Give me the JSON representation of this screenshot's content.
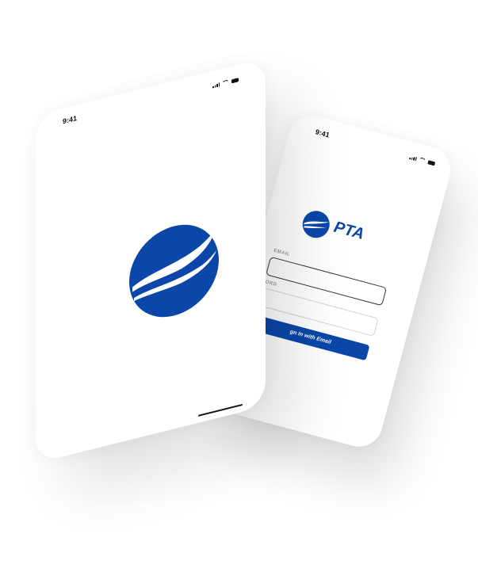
{
  "splash_screen": {
    "status_time": "9:41"
  },
  "login_screen": {
    "status_time": "9:41",
    "brand_name": "PTA",
    "email_label": "EMAIL",
    "password_label": "ORD",
    "sign_in_button_label": "gn In with Email"
  },
  "colors": {
    "brand_blue": "#0a47a9",
    "background": "#ffffff",
    "field_border": "#cfd3da"
  },
  "icons": [
    "signal-icon",
    "wifi-icon",
    "battery-icon",
    "pta-logo-icon"
  ]
}
